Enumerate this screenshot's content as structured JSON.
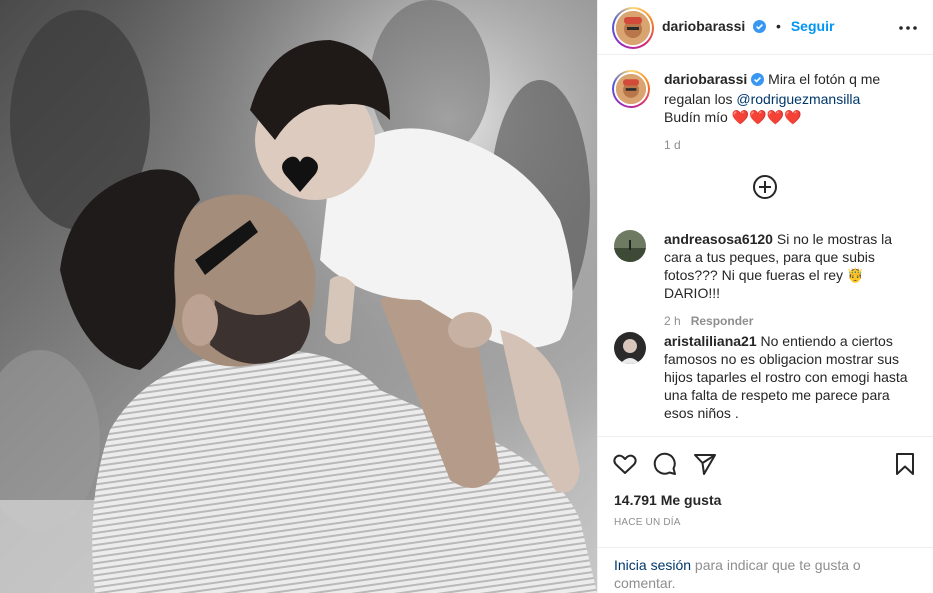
{
  "post": {
    "author": "dariobarassi",
    "follow_label": "Seguir",
    "separator": "•",
    "caption_prefix": "Mira el fotón q me regalan los",
    "caption_mention": "@rodriguezmansilla",
    "caption_line2": "Budín mío",
    "caption_hearts": "❤️❤️❤️❤️",
    "caption_time": "1 d"
  },
  "comments": [
    {
      "user": "andreasosa6120",
      "text": "Si no le mostras la cara a tus peques, para que subis fotos??? Ni que fueras el rey 🤴 DARIO!!!",
      "time": "2 h",
      "reply_label": "Responder"
    },
    {
      "user": "aristaliliana21",
      "text": "No entiendo a ciertos famosos no es obligacion mostrar sus hijos taparles el rostro con emogi hasta una falta de respeto me parece para esos niños ."
    }
  ],
  "actions": {
    "likes": "14.791 Me gusta",
    "posted": "Hace un día"
  },
  "login_prompt": {
    "link": "Inicia sesión",
    "rest": " para indicar que te gusta o comentar."
  },
  "icons": {
    "verified": "verified-badge-icon",
    "more": "more-options-icon",
    "load_more": "plus-circle-icon",
    "like": "heart-icon",
    "comment": "comment-icon",
    "share": "send-icon",
    "save": "bookmark-icon"
  },
  "colors": {
    "accent": "#0095f6",
    "mention": "#00376b",
    "secondary_text": "#8e8e8e",
    "verified": "#3897f0"
  }
}
